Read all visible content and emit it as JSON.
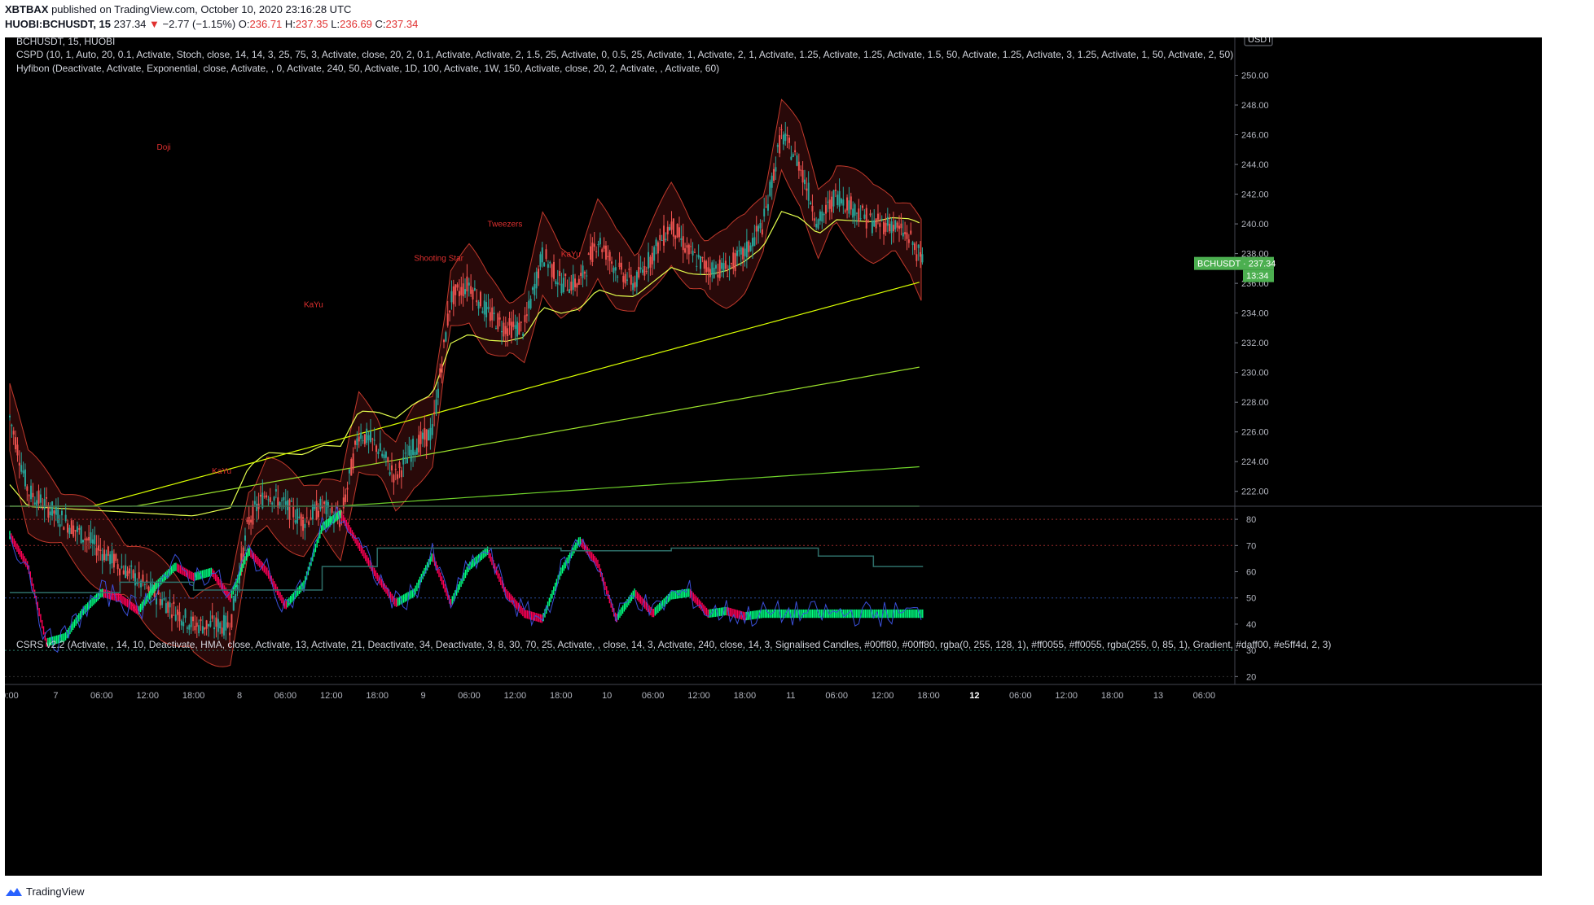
{
  "header": {
    "publisher": "XBTBAX",
    "published_text": "published on TradingView.com, October 10, 2020 23:16:28 UTC",
    "symbol": "HUOBI:BCHUSDT, 15",
    "last": "237.34",
    "change": "−2.77 (−1.15%)",
    "o_label": "O:",
    "o_value": "236.71",
    "h_label": "H:",
    "h_value": "237.35",
    "l_label": "L:",
    "l_value": "236.69",
    "c_label": "C:",
    "c_value": "237.34"
  },
  "legend": {
    "symbol": "BCHUSDT, 15, HUOBI",
    "cspd": "CSPD (10, 1, Auto, 20, 0.1, Activate, Stoch, close, 14, 14, 3, 25, 75, 3, Activate, close, 20, 2, 0.1, Activate, Activate, 2, 1.5, 25, Activate, 0, 0.5, 25, Activate, 1, Activate, 2, 1, Activate, 1.25, Activate, 1.25, Activate, 1.5, 50, Activate, 1.25, Activate, 3, 1.25, Activate, 1, 50, Activate, 2, 50)",
    "hyfibon": "Hyfibon (Deactivate, Activate, Exponential, close, Activate, , 0, Activate, 240, 50, Activate, 1D, 100, Activate, 1W, 150, Activate, close, 20, 2, Activate, , Activate, 60)",
    "csrs": "CSRS v2.2 (Activate, , 14, 10, Deactivate, HMA, close, Activate, 13, Activate, 21, Deactivate, 34, Deactivate, 3, 8, 30, 70, 25, Activate, , close, 14, 3, Activate, 240, close, 14, 3, Signalised Candles, #00ff80, #00ff80, rgba(0, 255, 128, 1), #ff0055, #ff0055, rgba(255, 0, 85, 1), Gradient, #daff00, #e5ff4d, 2, 3)"
  },
  "footer": {
    "brand": "TradingView"
  },
  "colors": {
    "bull": "#00ff80",
    "bear": "#ff0055",
    "background": "#000000",
    "price_label": "#4caf50",
    "red": "#e0302f"
  },
  "chart_data": [
    {
      "type": "line",
      "name": "price_pane",
      "title": "BCHUSDT, 15, HUOBI",
      "currency": "USDT",
      "ylim": [
        221,
        252
      ],
      "y_ticks": [
        "222.00",
        "224.00",
        "226.00",
        "228.00",
        "230.00",
        "232.00",
        "234.00",
        "236.00",
        "238.00",
        "240.00",
        "242.00",
        "244.00",
        "246.00",
        "248.00",
        "250.00"
      ],
      "last_price_label": "BCHUSDT · 237.34",
      "countdown_label": "13:34",
      "x_ticks": [
        "0:00",
        "7",
        "06:00",
        "12:00",
        "18:00",
        "8",
        "06:00",
        "12:00",
        "18:00",
        "9",
        "06:00",
        "12:00",
        "18:00",
        "10",
        "06:00",
        "12:00",
        "18:00",
        "11",
        "06:00",
        "12:00",
        "18:00",
        "12",
        "06:00",
        "12:00",
        "18:00",
        "13",
        "06:00"
      ],
      "annotations": [
        "Doji",
        "KaYu",
        "Shooting Star",
        "Tweezers",
        "KaYu",
        "KaYu"
      ],
      "series": [
        {
          "name": "close",
          "x_day": [
            6.0,
            6.1,
            6.2,
            6.3,
            6.4,
            6.5,
            6.6,
            6.7,
            6.8,
            6.9,
            7.0,
            7.1,
            7.2,
            7.3,
            7.4,
            7.5,
            7.6,
            7.7,
            7.8,
            7.9,
            8.0,
            8.1,
            8.2,
            8.3,
            8.4,
            8.5,
            8.6,
            8.7,
            8.8,
            8.9,
            9.0,
            9.1,
            9.2,
            9.3,
            9.4,
            9.5,
            9.6,
            9.7,
            9.8,
            9.9,
            10.0,
            10.1,
            10.2,
            10.3,
            10.4,
            10.5,
            10.6,
            10.7,
            10.8,
            10.9,
            10.97
          ],
          "values": [
            227,
            222,
            221,
            220,
            219,
            218,
            217,
            216,
            215,
            214,
            213,
            213,
            213,
            220,
            222,
            221,
            220,
            221,
            220,
            226,
            225,
            223,
            225,
            226,
            235,
            236,
            234,
            233,
            233,
            238,
            236,
            236,
            239,
            237,
            236,
            238,
            240,
            238,
            237,
            237,
            238,
            240,
            246,
            244,
            240,
            242,
            241,
            240,
            240,
            239,
            237.34
          ]
        }
      ]
    },
    {
      "type": "line",
      "name": "csrs_pane",
      "title": "CSRS v2.2",
      "ylim": [
        17,
        85
      ],
      "y_ticks": [
        "20",
        "30",
        "40",
        "50",
        "60",
        "70",
        "80"
      ],
      "levels": [
        30,
        50,
        70,
        80
      ],
      "series": [
        {
          "name": "signal",
          "x_day": [
            6.0,
            6.1,
            6.2,
            6.3,
            6.4,
            6.5,
            6.6,
            6.7,
            6.8,
            6.9,
            7.0,
            7.1,
            7.2,
            7.3,
            7.4,
            7.5,
            7.6,
            7.7,
            7.8,
            7.9,
            8.0,
            8.1,
            8.2,
            8.3,
            8.4,
            8.5,
            8.6,
            8.7,
            8.8,
            8.9,
            9.0,
            9.1,
            9.2,
            9.3,
            9.4,
            9.5,
            9.6,
            9.7,
            9.8,
            9.9,
            10.0,
            10.1,
            10.2,
            10.3,
            10.4,
            10.5,
            10.6,
            10.7,
            10.8,
            10.9,
            10.97
          ],
          "values": [
            74,
            62,
            33,
            35,
            45,
            52,
            50,
            45,
            55,
            62,
            58,
            60,
            50,
            68,
            60,
            47,
            55,
            77,
            82,
            70,
            58,
            48,
            52,
            66,
            48,
            62,
            68,
            52,
            44,
            42,
            60,
            72,
            63,
            42,
            52,
            44,
            51,
            52,
            44,
            45,
            43,
            44,
            44,
            44,
            44,
            44,
            44,
            44,
            44,
            44,
            44
          ]
        }
      ]
    }
  ]
}
